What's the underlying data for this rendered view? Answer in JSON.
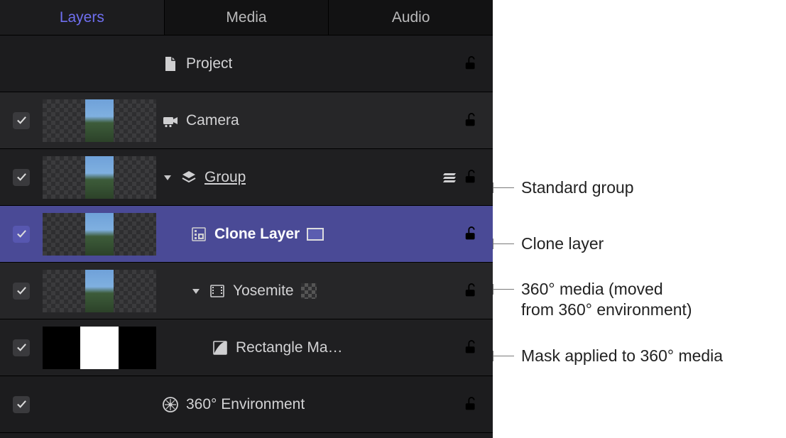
{
  "tabs": {
    "layers": "Layers",
    "media": "Media",
    "audio": "Audio"
  },
  "rows": {
    "project": {
      "label": "Project"
    },
    "camera": {
      "label": "Camera"
    },
    "group": {
      "label": "Group"
    },
    "clone": {
      "label": "Clone Layer"
    },
    "yosemite": {
      "label": "Yosemite"
    },
    "mask": {
      "label": "Rectangle Ma…"
    },
    "env360": {
      "label": "360° Environment"
    }
  },
  "annotations": {
    "group": "Standard group",
    "clone": "Clone layer",
    "media360_l1": "360° media (moved",
    "media360_l2": "from 360° environment)",
    "mask": "Mask applied to 360° media"
  }
}
